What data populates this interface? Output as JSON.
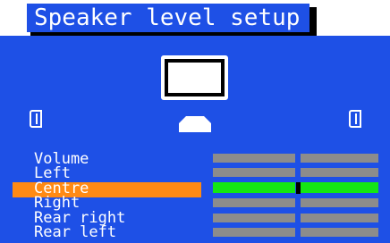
{
  "title": "Speaker level setup",
  "colors": {
    "background": "#1e50e6",
    "highlight": "#ff8a14",
    "active_bar": "#14e614",
    "inactive_bar": "#8c8c8c"
  },
  "channels": [
    {
      "label": "Volume",
      "selected": false
    },
    {
      "label": "Left",
      "selected": false
    },
    {
      "label": "Centre",
      "selected": true
    },
    {
      "label": "Right",
      "selected": false
    },
    {
      "label": "Rear right",
      "selected": false
    },
    {
      "label": "Rear left",
      "selected": false
    }
  ],
  "icons": [
    "tv-icon",
    "left-speaker-icon",
    "centre-speaker-icon",
    "right-speaker-icon"
  ]
}
